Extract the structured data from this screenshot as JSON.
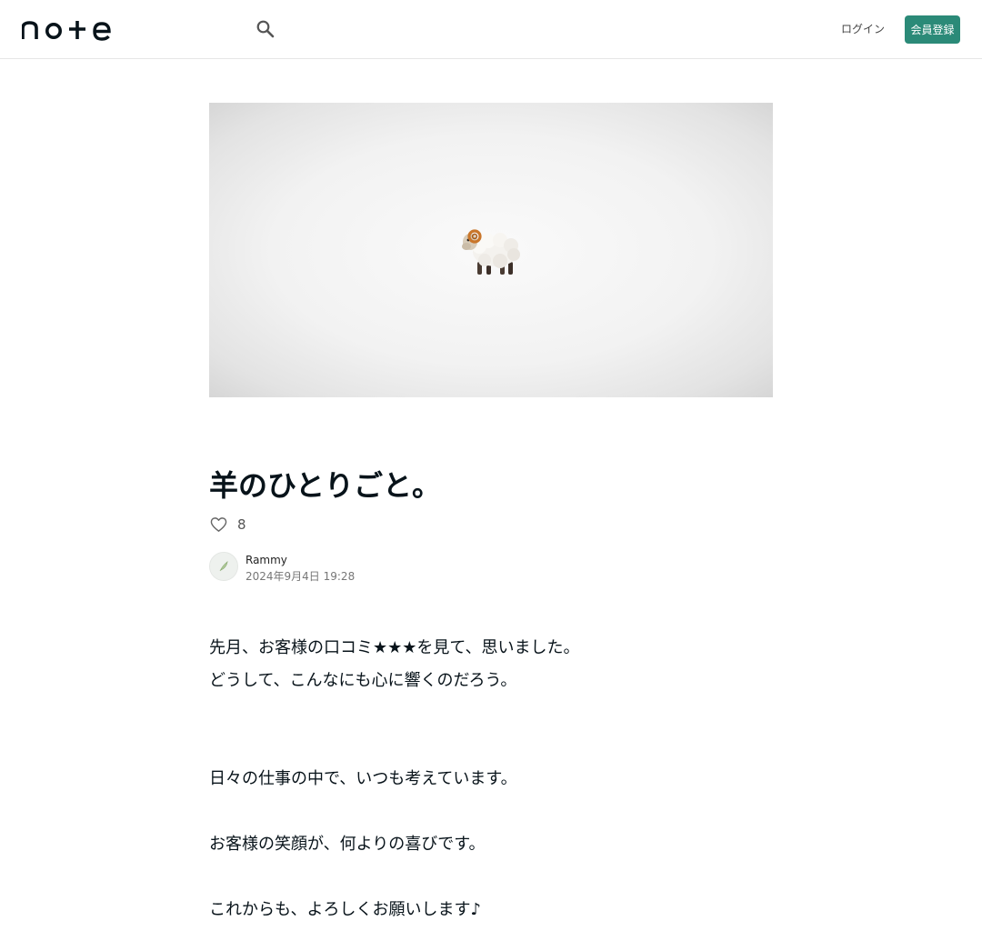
{
  "header": {
    "logo_text": "note",
    "login_label": "ログイン",
    "signup_label": "会員登録"
  },
  "article": {
    "title": "羊のひとりごと。",
    "like_count": "8",
    "author": {
      "name": "Rammy",
      "date": "2024年9月4日 19:28"
    },
    "paragraphs": [
      "先月、お客様の口コミ★★★を見て、思いました。",
      "どうして、こんなにも心に響くのだろう。",
      "日々の仕事の中で、いつも考えています。",
      "お客様の笑顔が、何よりの喜びです。",
      "これからも、よろしくお願いします♪"
    ]
  },
  "icons": {
    "search": "search-icon",
    "like": "heart-outline-icon",
    "hero": "sheep-emoji",
    "avatar": "feather-avatar-icon"
  },
  "colors": {
    "accent": "#2b8a78",
    "text": "#08131a",
    "muted": "#777777"
  }
}
